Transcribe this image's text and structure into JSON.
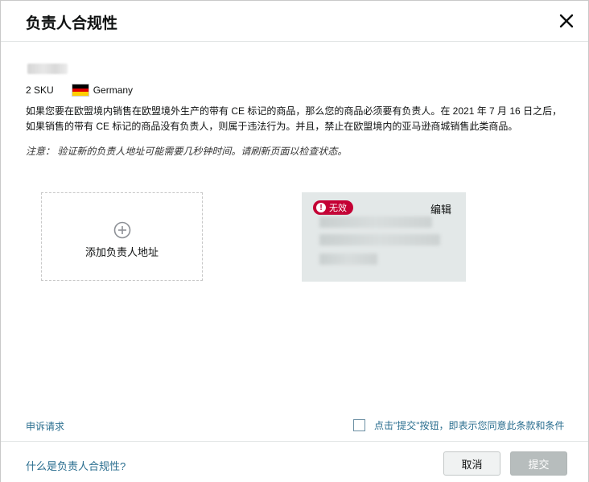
{
  "dialog": {
    "title": "负责人合规性"
  },
  "product": {
    "sku_count": "2 SKU",
    "country": "Germany",
    "flag_colors": [
      "#000000",
      "#dd0000",
      "#ffce00"
    ]
  },
  "content": {
    "line1": "如果您要在欧盟境内销售在欧盟境外生产的带有 CE 标记的商品，那么您的商品必须要有负责人。在 2021 年 7 月 16 日之后，",
    "line2": "如果销售的带有 CE 标记的商品没有负责人，则属于违法行为。并且，禁止在欧盟境内的亚马逊商城销售此类商品。",
    "note": "注意： 验证新的负责人地址可能需要几秒钟时间。请刷新页面以检查状态。"
  },
  "add_card": {
    "icon": "plus-circle-icon",
    "label": "添加负责人地址"
  },
  "address_card": {
    "status_badge": "无效",
    "status_color": "#c40034",
    "edit_label": "编辑"
  },
  "actions": {
    "appeal_link": "申诉请求",
    "agree_text": "点击\"提交\"按钮，即表示您同意此条款和条件",
    "agree_checked": false,
    "help_link": "什么是负责人合规性?",
    "cancel_label": "取消",
    "submit_label": "提交"
  },
  "colors": {
    "link": "#2a6e8f",
    "submit_disabled": "#b7bdbd"
  }
}
